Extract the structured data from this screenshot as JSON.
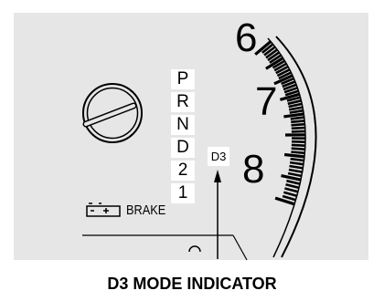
{
  "gear_positions": [
    "P",
    "R",
    "N",
    "D",
    "2",
    "1"
  ],
  "d3_light_label": "D3",
  "rpm_numbers": [
    "6",
    "7",
    "8"
  ],
  "brake_label": "BRAKE",
  "caption": "D3 MODE INDICATOR",
  "colors": {
    "panel": "#e6e6e6",
    "ink": "#000000",
    "label_bg": "#ffffff"
  }
}
